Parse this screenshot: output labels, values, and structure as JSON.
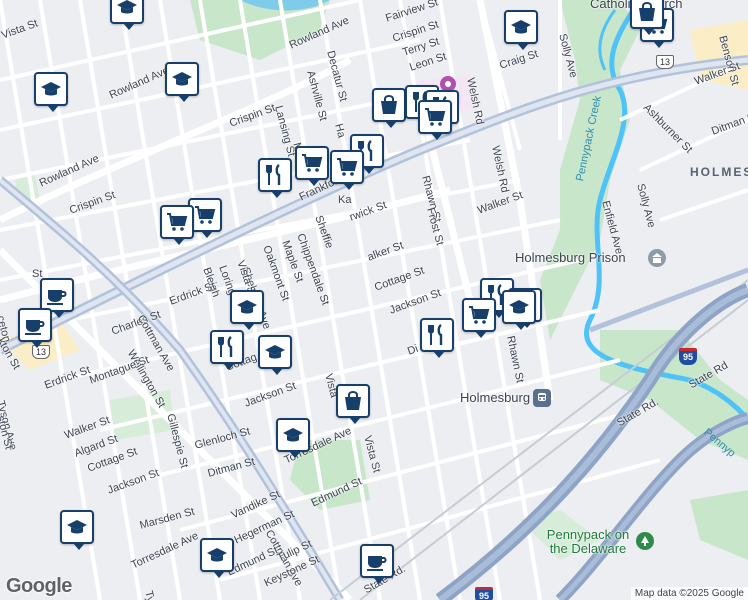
{
  "streets": {
    "rowland_ave_top": "Rowland Ave",
    "rowland_ave_mid": "Rowland Ave",
    "rowland_ave_left": "Rowland Ave",
    "decatur_st": "Decatur St",
    "ashville_st": "Ashville St",
    "fairview_st": "Fairview St",
    "crispin_st_top": "Crispin St",
    "terry_st": "Terry St",
    "leon_st": "Leon St",
    "vista_st_top": "Vista St",
    "welsh_rd_top": "Welsh Rd",
    "welsh_rd_mid": "Welsh Rd",
    "solly_ave_top": "Solly Ave",
    "craig_st": "Craig St",
    "benson_st": "Benson St",
    "walker_st_right": "Walker St",
    "ashburner_st": "Ashburner St",
    "ditman_st_right": "Ditman St",
    "lansing_st": "Lansing St",
    "crispin_st_mid": "Crispin St",
    "crispin_st_left": "Crispin St",
    "rhawn_st_top": "Rhawn St",
    "frost_st": "Frost St",
    "walker_st_mid": "Walker St",
    "frankford_ave": "Frankford Ave",
    "enfield_ave": "Enfield Ave",
    "solly_ave_mid": "Solly Ave",
    "pennypack_creek": "Pennypack Creek",
    "mayfair_st": "Me",
    "chippendale_st": "Chippendale St",
    "oakmont_st": "Oakmont St",
    "maple_st": "Maple St",
    "shelmire_ave": "Shelmire Ave",
    "loring_st": "Loring St",
    "vista_st_mid": "Vista St",
    "bleigh_ave": "Bleigh",
    "sheffield_ave": "Sheffie",
    "erdrick_st_top": "Erdrick St",
    "walker_st_2": "Walker St",
    "cottage_st_mid": "Cottage St",
    "jackson_st_mid": "Jackson St",
    "ditman_st_mid": "Di",
    "rhawn_st_mid": "Rhawn St",
    "charles_st": "Charles St",
    "wellington_st": "Wellington St",
    "erdrick_st_left": "Erdrick St",
    "erdrick_st_left2": "Erdrick St",
    "cottman_ave_top": "Cottman Ave",
    "cottman_ave_bottom": "Cottman Ave",
    "tyson_ave": "Tyson Ave",
    "montague_st": "Montague St",
    "walker_st_left": "Walker St",
    "algard_st": "Algard St",
    "cottage_st_left": "Cottage St",
    "cottage_st_2": "Cottag",
    "gillespie_st": "Gillespie St",
    "jackson_st_left": "Jackson St",
    "jackson_st_left2": "Jackson St",
    "glenloch_st": "Glenloch St",
    "ditman_st_left": "Ditman St",
    "torresdale_ave_mid": "Torresdale Ave",
    "torresdale_ave_left": "Torresdale Ave",
    "vista_st_bottom": "Vista St",
    "vista_st_bottom2": "Vista",
    "edmund_st": "Edmund St",
    "edmund_st_2": "Edmund St",
    "marsden_st": "Marsden St",
    "vandike_st": "Vandike St",
    "hegerman_st": "Hegerman St",
    "tulip_st": "Tulip St",
    "keystone_st": "Keystone St",
    "state_rd_right": "State Rd",
    "state_rd_right2": "State Rd.",
    "state_rd_bottom": "State Rd.",
    "pennypack_right": "Pennyp",
    "cecil_st_left": "ceton",
    "kton_st": "kton St",
    "ston_st": "ston St",
    "ckton": "ckton",
    "fton": "fton",
    "ton_st": "ton St",
    "ct_st": "St",
    "tys": "Tys",
    "harbison": "Ha",
    "ka_st": "Ka",
    "rwick_st": "rwick St",
    "lker_st": "alker St",
    "ne_st": "e St"
  },
  "places": {
    "catholic_church": "Catholic Church",
    "holmesburg_prison": "Holmesburg Prison",
    "holmesburg": "Holmesburg",
    "holmes_hood": "HOLMES",
    "pennypack_on_delaware": "Pennypack on the Delaware"
  },
  "shields": {
    "us13_left": "13",
    "us13_right": "13",
    "i95_mid": "95",
    "i95_bottom": "95"
  },
  "pins": [
    {
      "icon": "school"
    },
    {
      "icon": "shopping-cart"
    },
    {
      "icon": "school"
    },
    {
      "icon": "school"
    },
    {
      "icon": "shopping-bag"
    },
    {
      "icon": "school"
    },
    {
      "icon": "shopping-bag"
    },
    {
      "icon": "restaurant"
    },
    {
      "icon": "restaurant"
    },
    {
      "icon": "shopping-cart"
    },
    {
      "icon": "restaurant"
    },
    {
      "icon": "shopping-cart"
    },
    {
      "icon": "shopping-cart"
    },
    {
      "icon": "restaurant"
    },
    {
      "icon": "shopping-cart"
    },
    {
      "icon": "coffee"
    },
    {
      "icon": "coffee"
    },
    {
      "icon": "school"
    },
    {
      "icon": "restaurant"
    },
    {
      "icon": "school"
    },
    {
      "icon": "restaurant"
    },
    {
      "icon": "restaurant"
    },
    {
      "icon": "shopping-cart"
    },
    {
      "icon": "school"
    },
    {
      "icon": "shopping-bag"
    },
    {
      "icon": "school"
    },
    {
      "icon": "school"
    },
    {
      "icon": "school"
    },
    {
      "icon": "coffee"
    },
    {
      "icon": "school"
    },
    {
      "icon": "shopping-cart"
    }
  ],
  "logo": "Google",
  "attribution": "Map data ©2025 Google",
  "colors": {
    "pin_border": "#173f6b",
    "park": "#c8e6c9",
    "water": "#4fc3f7",
    "highway": "#8ea4c6",
    "road": "#ffffff"
  }
}
